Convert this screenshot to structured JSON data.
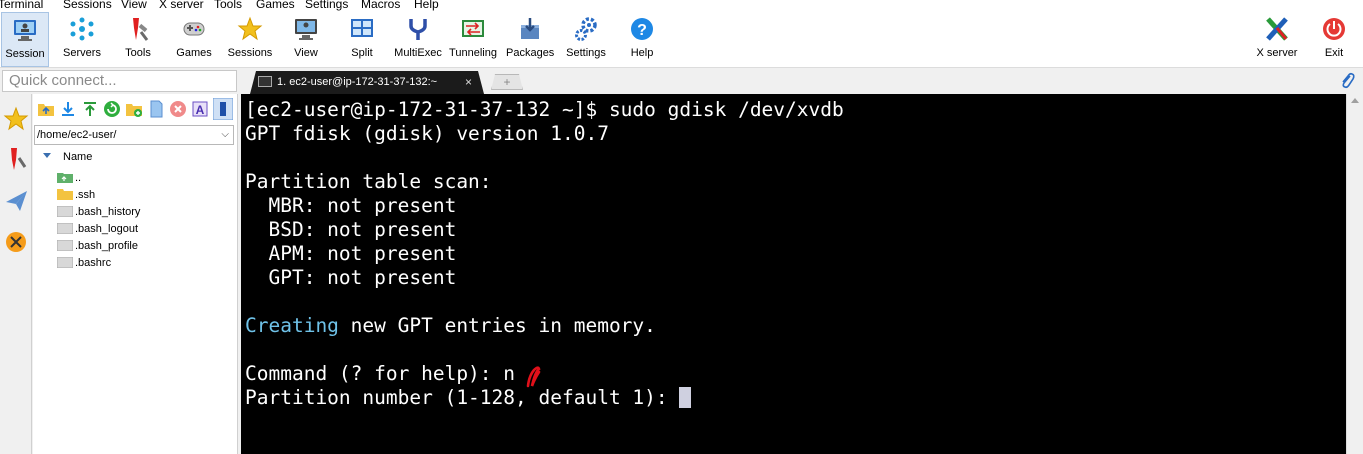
{
  "menu": [
    "Terminal",
    "Sessions",
    "View",
    "X server",
    "Tools",
    "Games",
    "Settings",
    "Macros",
    "Help"
  ],
  "toolbar": {
    "session": "Session",
    "servers": "Servers",
    "tools": "Tools",
    "games": "Games",
    "sessions": "Sessions",
    "view": "View",
    "split": "Split",
    "multiexec": "MultiExec",
    "tunneling": "Tunneling",
    "packages": "Packages",
    "settings": "Settings",
    "help": "Help",
    "xserver": "X server",
    "exit": "Exit"
  },
  "quick_connect": {
    "placeholder": "Quick connect..."
  },
  "tab": {
    "title": "1. ec2-user@ip-172-31-37-132:~",
    "close": "×",
    "new": "+"
  },
  "file_browser": {
    "path": "/home/ec2-user/",
    "column": "Name",
    "items": [
      "..",
      ".ssh",
      ".bash_history",
      ".bash_logout",
      ".bash_profile",
      ".bashrc"
    ]
  },
  "terminal": {
    "lines": [
      "[ec2-user@ip-172-31-37-132 ~]$ sudo gdisk /dev/xvdb",
      "GPT fdisk (gdisk) version 1.0.7",
      "",
      "Partition table scan:",
      "  MBR: not present",
      "  BSD: not present",
      "  APM: not present",
      "  GPT: not present",
      "",
      "",
      "",
      "Command (? for help): n",
      "Partition number (1-128, default 1): "
    ],
    "creating_word": "Creating",
    "creating_rest": " new GPT entries in memory."
  },
  "colors": {
    "terminal_bg": "#000000",
    "terminal_fg": "#ffffff",
    "highlight": "#6fc2e8",
    "annotation": "#e0101a"
  },
  "icons": {
    "session": "monitor-icon",
    "servers": "network-icon",
    "tools": "tools-icon",
    "games": "gamepad-icon",
    "sessions": "star-icon",
    "view": "monitor-view-icon",
    "split": "split-icon",
    "multiexec": "fork-icon",
    "tunneling": "tunnel-icon",
    "packages": "package-icon",
    "settings": "gears-icon",
    "help": "help-icon",
    "xserver": "x-icon",
    "exit": "power-icon"
  }
}
